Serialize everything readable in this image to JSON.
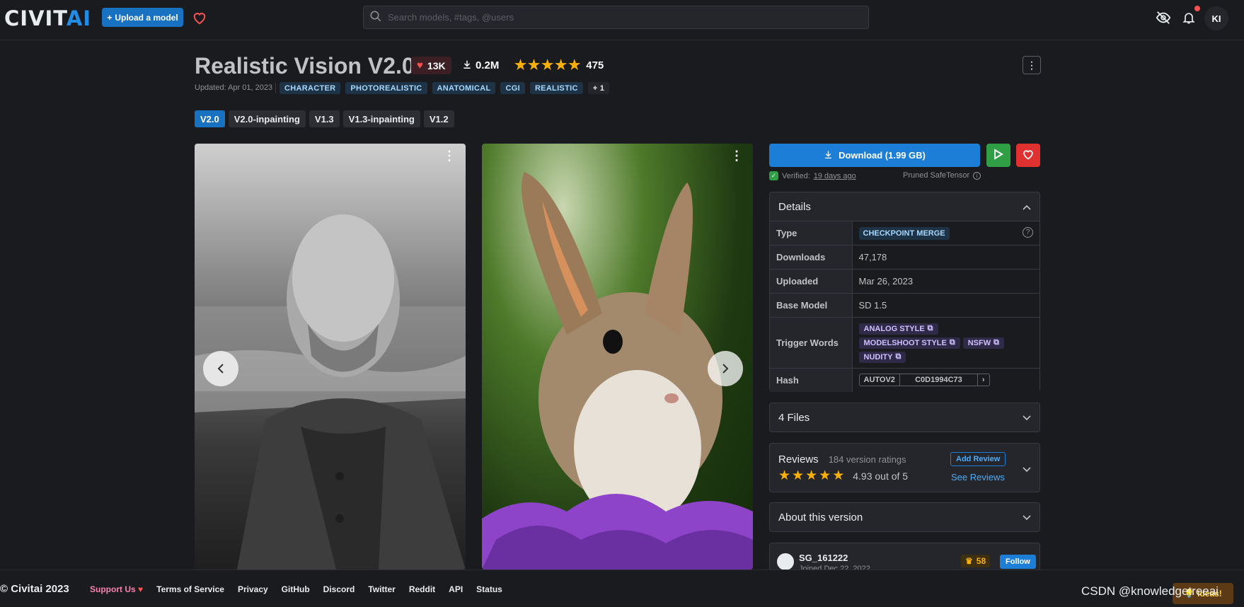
{
  "header": {
    "logo_main": "CIVIT",
    "logo_ai": "AI",
    "upload_label": "Upload a model",
    "search_placeholder": "Search models, #tags, @users",
    "avatar_initials": "KI"
  },
  "model": {
    "title": "Realistic Vision V2.0",
    "likes": "13K",
    "downloads": "0.2M",
    "rating_stars": 5,
    "rating_count": "475",
    "updated": "Updated: Apr 01, 2023",
    "tags": [
      "CHARACTER",
      "PHOTOREALISTIC",
      "ANATOMICAL",
      "CGI",
      "REALISTIC"
    ],
    "tags_more": "+ 1",
    "versions": [
      {
        "label": "V2.0",
        "active": true
      },
      {
        "label": "V2.0-inpainting",
        "active": false
      },
      {
        "label": "V1.3",
        "active": false
      },
      {
        "label": "V1.3-inpainting",
        "active": false
      },
      {
        "label": "V1.2",
        "active": false
      }
    ]
  },
  "actions": {
    "download_label": "Download (1.99 GB)",
    "verified_label": "Verified:",
    "verified_when": "19 days ago",
    "file_format": "Pruned SafeTensor"
  },
  "details": {
    "title": "Details",
    "rows": {
      "type_key": "Type",
      "type_val": "CHECKPOINT MERGE",
      "downloads_key": "Downloads",
      "downloads_val": "47,178",
      "uploaded_key": "Uploaded",
      "uploaded_val": "Mar 26, 2023",
      "base_key": "Base Model",
      "base_val": "SD 1.5",
      "trigger_key": "Trigger Words",
      "trigger_words": [
        "ANALOG STYLE",
        "MODELSHOOT STYLE",
        "NSFW",
        "NUDITY"
      ],
      "hash_key": "Hash",
      "hash_algo": "AUTOV2",
      "hash_val": "C0D1994C73"
    }
  },
  "files": {
    "title": "4 Files"
  },
  "reviews": {
    "title": "Reviews",
    "count_label": "184 version ratings",
    "score_label": "4.93 out of 5",
    "stars": 5,
    "add_label": "Add Review",
    "see_label": "See Reviews"
  },
  "about": {
    "title": "About this version"
  },
  "creator": {
    "username": "SG_161222",
    "joined": "Joined Dec 22, 2022",
    "score": "58",
    "follow_label": "Follow"
  },
  "footer": {
    "copyright": "© Civitai 2023",
    "links": [
      "Support Us",
      "Terms of Service",
      "Privacy",
      "GitHub",
      "Discord",
      "Twitter",
      "Reddit",
      "API",
      "Status"
    ],
    "ideas_label": "Ideas!"
  },
  "watermark": "CSDN @knowledgetreeai",
  "colors": {
    "accent": "#1c7ed6",
    "brand_ai": "#228be6",
    "star": "#fab005",
    "danger": "#e03131",
    "success": "#2f9e44"
  }
}
